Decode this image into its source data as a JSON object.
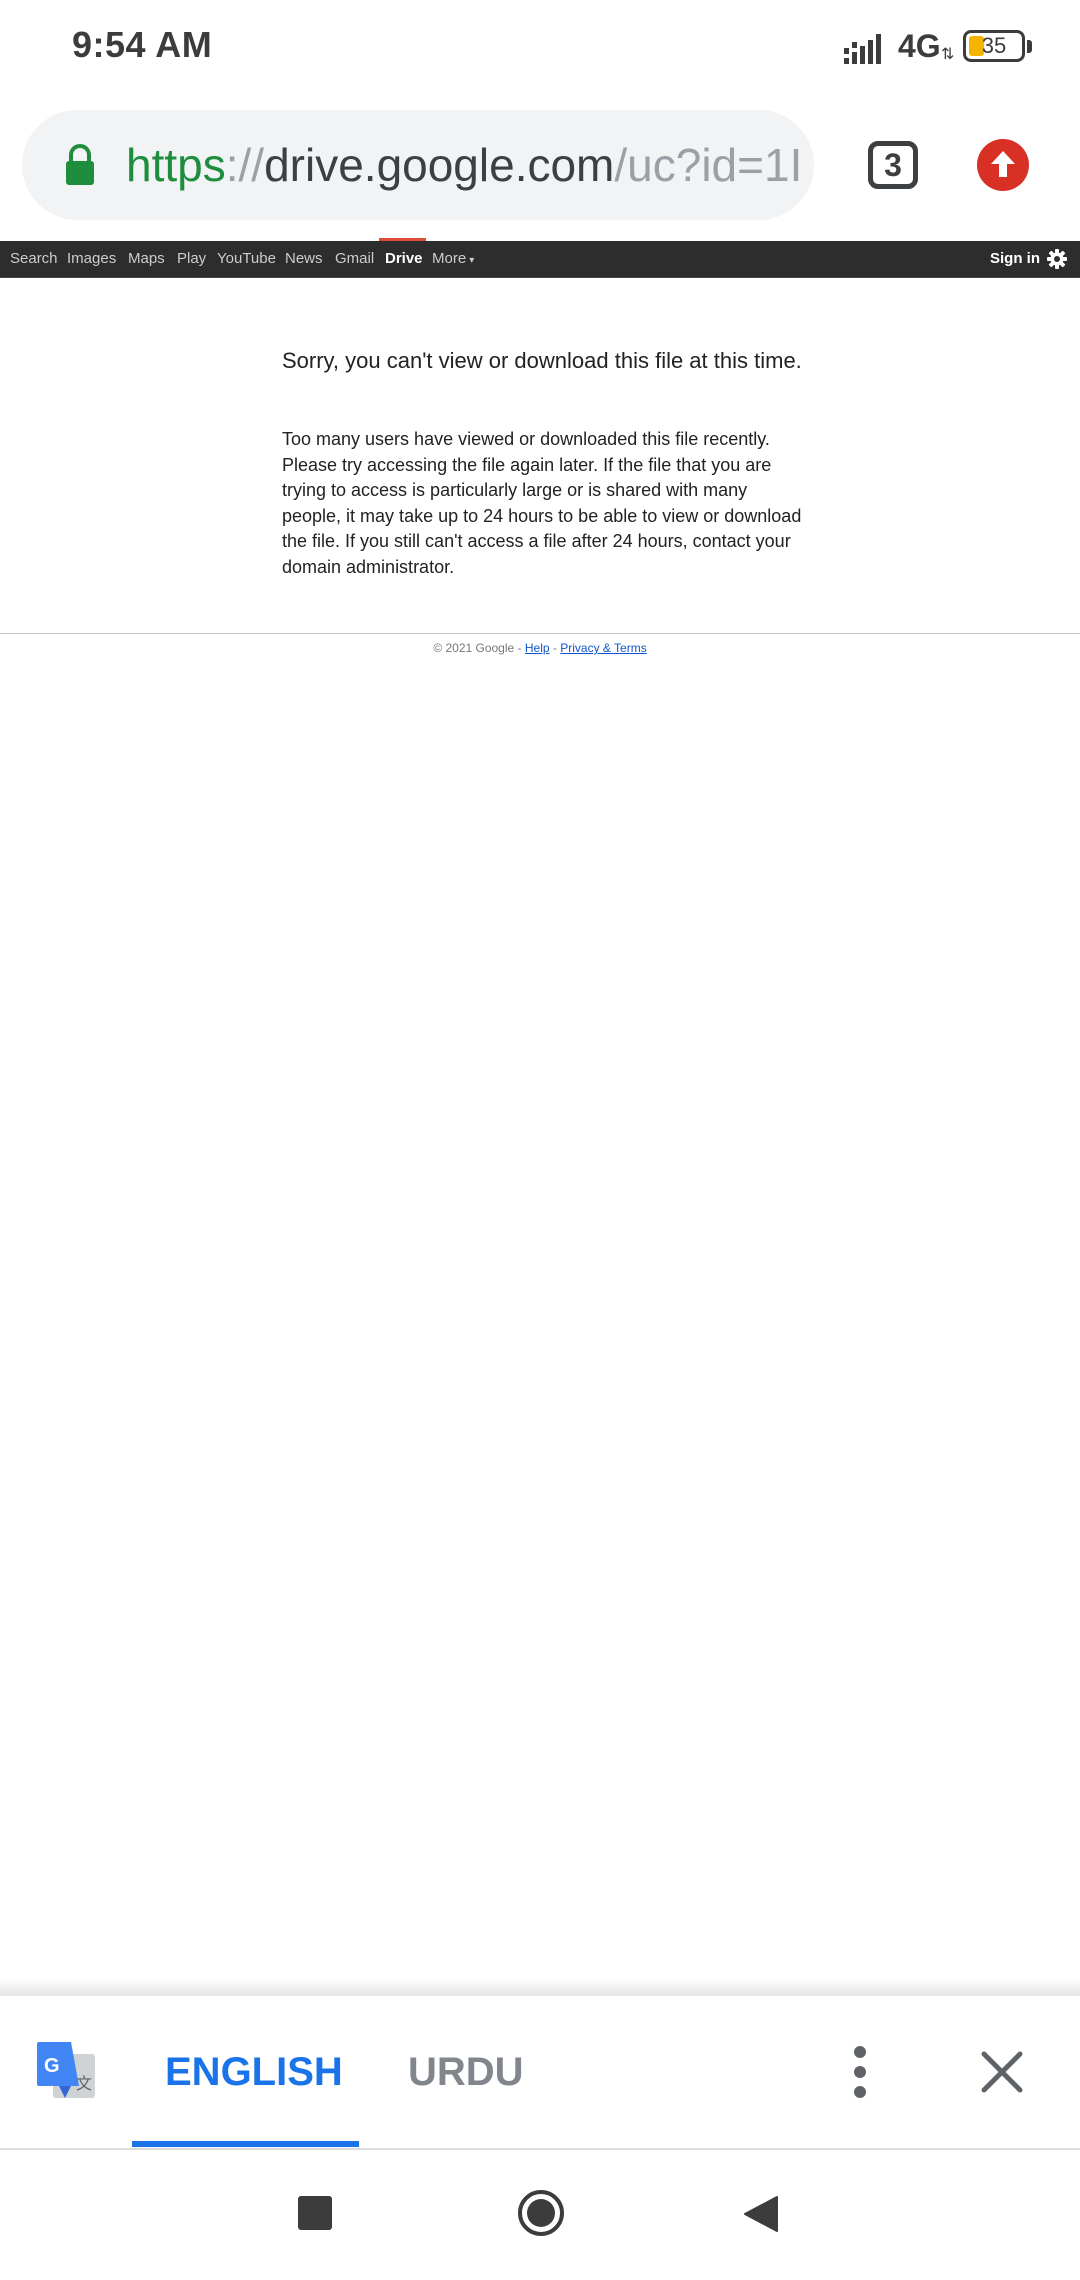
{
  "status_bar": {
    "time": "9:54 AM",
    "network": "4G",
    "battery": "35",
    "icons": [
      "signal-icon",
      "network-arrows-icon",
      "battery-icon"
    ]
  },
  "browser": {
    "url": {
      "scheme": "https",
      "separator": "://",
      "host": "drive.google.com",
      "path": "/uc?id=1I"
    },
    "tab_count": "3",
    "icons": [
      "lock-icon",
      "tabs-icon",
      "update-icon"
    ],
    "colors": {
      "secure": "#1e8e3e",
      "update": "#d93025"
    }
  },
  "gbar": {
    "items": [
      "Search",
      "Images",
      "Maps",
      "Play",
      "YouTube",
      "News",
      "Gmail",
      "Drive",
      "More"
    ],
    "active": "Drive",
    "sign_in": "Sign in",
    "colors": {
      "background": "#2d2d2d",
      "active_marker": "#dd4b39"
    }
  },
  "message": {
    "title": "Sorry, you can't view or download this file at this time.",
    "body": "Too many users have viewed or downloaded this file recently. Please try accessing the file again later. If the file that you are trying to access is particularly large or is shared with many people, it may take up to 24 hours to be able to view or download the file. If you still can't access a file after 24 hours, contact your domain administrator."
  },
  "footer": {
    "copyright": "© 2021 Google",
    "separator": " - ",
    "help": "Help",
    "privacy": "Privacy & Terms"
  },
  "translate_bar": {
    "languages": [
      "ENGLISH",
      "URDU"
    ],
    "selected": "ENGLISH",
    "icons": [
      "google-translate-icon",
      "more-vert-icon",
      "close-icon"
    ],
    "colors": {
      "accent": "#1a73e8"
    }
  },
  "android_nav": {
    "icons": [
      "recents-icon",
      "home-icon",
      "back-icon"
    ]
  }
}
